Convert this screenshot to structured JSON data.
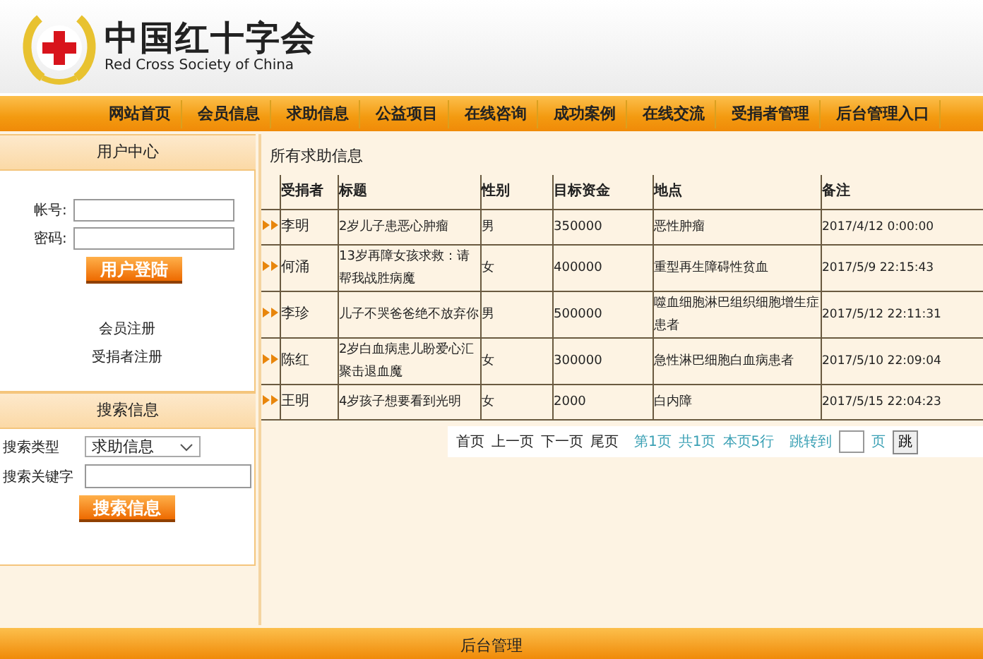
{
  "header": {
    "logo_title": "中国红十字会",
    "logo_subtitle": "Red Cross Society of China"
  },
  "nav": [
    "网站首页",
    "会员信息",
    "求助信息",
    "公益项目",
    "在线咨询",
    "成功案例",
    "在线交流",
    "受捐者管理",
    "后台管理入口"
  ],
  "sidebar": {
    "user_center": {
      "title": "用户中心",
      "account_label": "帐号:",
      "password_label": "密码:",
      "login_button": "用户登陆",
      "links": [
        "会员注册",
        "受捐者注册"
      ]
    },
    "search": {
      "title": "搜索信息",
      "type_label": "搜索类型",
      "type_value": "求助信息",
      "keyword_label": "搜索关键字",
      "button": "搜索信息"
    }
  },
  "main": {
    "heading": "所有求助信息",
    "table": {
      "columns": [
        "受捐者",
        "标题",
        "性别",
        "目标资金",
        "地点",
        "备注"
      ],
      "rows": [
        [
          "李明",
          "2岁儿子患恶心肿瘤",
          "男",
          "350000",
          "恶性肿瘤",
          "2017/4/12 0:00:00"
        ],
        [
          "何涌",
          "13岁再障女孩求救：请帮我战胜病魔",
          "女",
          "400000",
          "重型再生障碍性贫血",
          "2017/5/9 22:15:43"
        ],
        [
          "李珍",
          "儿子不哭爸爸绝不放弃你",
          "男",
          "500000",
          "噬血细胞淋巴组织细胞增生症患者",
          "2017/5/12 22:11:31"
        ],
        [
          "陈红",
          "2岁白血病患儿盼爱心汇聚击退血魔",
          "女",
          "300000",
          "急性淋巴细胞白血病患者",
          "2017/5/10 22:09:04"
        ],
        [
          "王明",
          "4岁孩子想要看到光明",
          "女",
          "2000",
          "白内障",
          "2017/5/15 22:04:23"
        ]
      ]
    },
    "pagination": {
      "links": [
        "首页",
        "上一页",
        "下一页",
        "尾页"
      ],
      "info": [
        "第1页",
        "共1页",
        "本页5行"
      ],
      "jump_label": "跳转到",
      "page_suffix": "页",
      "jump_button": "跳"
    }
  },
  "footer": "后台管理"
}
